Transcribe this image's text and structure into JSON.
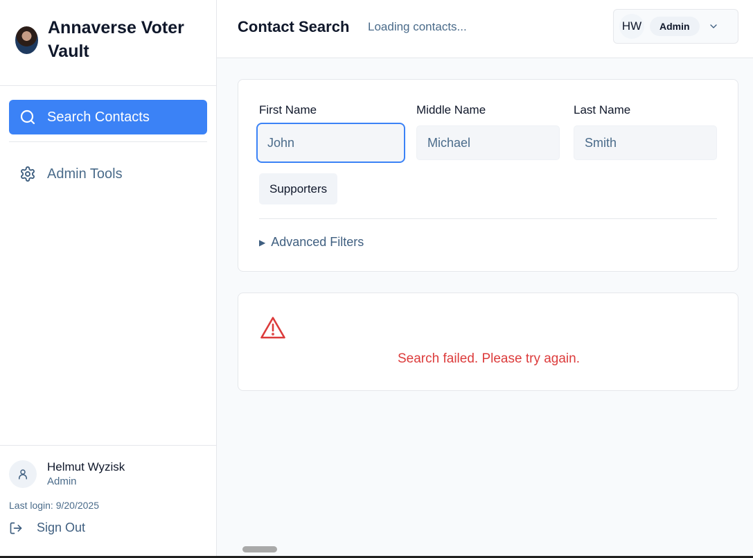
{
  "app": {
    "title": "Annaverse Voter Vault"
  },
  "sidebar": {
    "nav": [
      {
        "label": "Search Contacts",
        "icon": "search-icon",
        "active": true
      },
      {
        "label": "Admin Tools",
        "icon": "gear-icon",
        "active": false
      }
    ],
    "user": {
      "name": "Helmut Wyzisk",
      "role": "Admin",
      "last_login": "Last login: 9/20/2025"
    },
    "sign_out_label": "Sign Out"
  },
  "header": {
    "title": "Contact Search",
    "status": "Loading contacts...",
    "user_menu": {
      "initials": "HW",
      "role": "Admin",
      "icon": "chevron-down-icon"
    }
  },
  "search_form": {
    "fields": [
      {
        "label": "First Name",
        "placeholder": "John",
        "value": ""
      },
      {
        "label": "Middle Name",
        "placeholder": "Michael",
        "value": ""
      },
      {
        "label": "Last Name",
        "placeholder": "Smith",
        "value": ""
      }
    ],
    "chip_label": "Supporters",
    "advanced_filters_label": "Advanced Filters"
  },
  "error": {
    "icon": "warning-icon",
    "message": "Search failed. Please try again."
  },
  "colors": {
    "accent": "#3b82f6",
    "error": "#dc3b3b",
    "muted_text": "#4a6b8a"
  }
}
